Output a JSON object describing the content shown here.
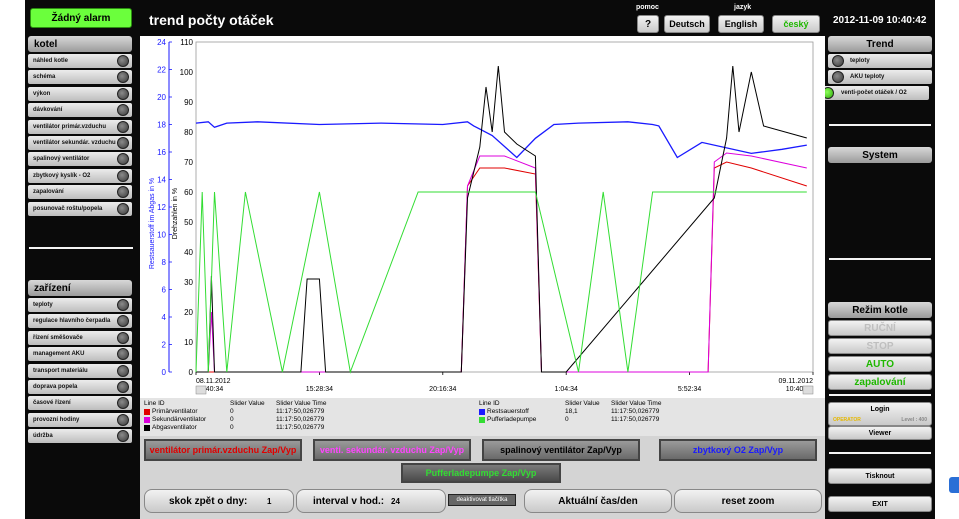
{
  "header": {
    "alarm_label": "Žádný alarm",
    "title": "trend počty otáček",
    "help_caption": "pomoc",
    "help_button": "?",
    "lang_caption": "jazyk",
    "lang_de": "Deutsch",
    "lang_en": "English",
    "lang_cz": "český",
    "datetime": "2012-11-09 10:40:42"
  },
  "left": {
    "kotel_head": "kotel",
    "kotel_items": [
      "náhled kotle",
      "schéma",
      "výkon",
      "dávkování",
      "ventilátor primár.vzduchu",
      "ventilátor sekundár. vzduchu",
      "spalinový ventilátor",
      "zbytkový kyslík - O2",
      "zapalování",
      "posunovač roštu/popela"
    ],
    "zarizeni_head": "zařízení",
    "zarizeni_items": [
      "teploty",
      "regulace hlavního čerpadla",
      "řízení směšovače",
      "management AKU",
      "transport materiálu",
      "doprava popela",
      "časové řízení",
      "provozní hodiny",
      "údržba"
    ]
  },
  "right": {
    "trend_head": "Trend",
    "trend_items": [
      "teploty",
      "AKU teploty",
      "venti-počet otáček / O2"
    ],
    "system_head": "System",
    "rezim_head": "Režim kotle",
    "modes": [
      "RUČNÍ",
      "STOP",
      "AUTO",
      "zapalování"
    ],
    "login": "Login",
    "operator": "OPERATOR",
    "level": "Level : 400",
    "viewer": "Viewer",
    "print": "Tisknout",
    "exit": "EXIT"
  },
  "chart_data": {
    "type": "line",
    "y_left_label": "Restsauerstoff im Abgas in %",
    "y_left_ticks": [
      "24",
      "22",
      "20",
      "18",
      "16",
      "14",
      "12",
      "10",
      "8",
      "6",
      "4",
      "2",
      "0"
    ],
    "y_left_range": [
      0,
      24
    ],
    "y_right_label": "Drehzahlen in %",
    "y_right_ticks": [
      "110",
      "100",
      "90",
      "80",
      "70",
      "60",
      "50",
      "40",
      "30",
      "20",
      "10",
      "0"
    ],
    "y_right_range": [
      0,
      110
    ],
    "x_ticks": [
      {
        "l1": "08.11.2012",
        "l2": "10:40:34"
      },
      {
        "l1": "",
        "l2": "15:28:34"
      },
      {
        "l1": "",
        "l2": "20:16:34"
      },
      {
        "l1": "",
        "l2": "1:04:34"
      },
      {
        "l1": "",
        "l2": "5:52:34"
      },
      {
        "l1": "09.11.2012",
        "l2": "10:40:34"
      }
    ],
    "series": [
      {
        "name": "Restsauerstoff",
        "color": "#1a1aff",
        "axis": "left",
        "x": [
          0,
          0.02,
          0.03,
          0.05,
          0.1,
          0.2,
          0.3,
          0.4,
          0.44,
          0.45,
          0.48,
          0.52,
          0.55,
          0.58,
          0.62,
          0.7,
          0.74,
          0.75,
          0.78,
          0.82,
          0.9,
          0.95,
          0.99
        ],
        "y": [
          18.1,
          18.2,
          17.8,
          18.1,
          18.2,
          18.0,
          18.1,
          18.0,
          18.2,
          17.9,
          17.2,
          15.6,
          17.0,
          18.0,
          18.1,
          18.2,
          18.0,
          17.9,
          15.6,
          16.7,
          15.9,
          16.2,
          16.5
        ]
      },
      {
        "name": "Primärventilator",
        "color": "#e00000",
        "axis": "right",
        "x": [
          0,
          0.43,
          0.44,
          0.46,
          0.5,
          0.55,
          0.56,
          0.6,
          0.7,
          0.83,
          0.84,
          0.86,
          0.9,
          0.99
        ],
        "y": [
          0,
          0,
          62,
          68,
          68,
          66,
          0,
          0,
          0,
          0,
          68,
          70,
          68,
          62
        ]
      },
      {
        "name": "Sekundärventilator",
        "color": "#dd00dd",
        "axis": "right",
        "x": [
          0,
          0.02,
          0.025,
          0.03,
          0.43,
          0.44,
          0.46,
          0.5,
          0.55,
          0.56,
          0.6,
          0.83,
          0.84,
          0.86,
          0.9,
          0.99
        ],
        "y": [
          0,
          0,
          20,
          0,
          0,
          62,
          72,
          72,
          68,
          0,
          0,
          0,
          70,
          73,
          72,
          68
        ]
      },
      {
        "name": "Abgasventilator",
        "color": "#000000",
        "axis": "right",
        "x": [
          0,
          0.02,
          0.025,
          0.03,
          0.17,
          0.18,
          0.2,
          0.21,
          0.43,
          0.44,
          0.46,
          0.47,
          0.48,
          0.49,
          0.5,
          0.52,
          0.55,
          0.56,
          0.6,
          0.84,
          0.86,
          0.87,
          0.88,
          0.9,
          0.92,
          0.99
        ],
        "y": [
          0,
          0,
          32,
          0,
          0,
          31,
          31,
          0,
          0,
          58,
          75,
          95,
          80,
          102,
          80,
          76,
          72,
          0,
          0,
          58,
          78,
          102,
          80,
          100,
          82,
          78
        ]
      },
      {
        "name": "Pufferladepumpe",
        "color": "#33dd33",
        "axis": "right",
        "x": [
          0,
          0.01,
          0.02,
          0.03,
          0.05,
          0.08,
          0.14,
          0.2,
          0.25,
          0.36,
          0.44,
          0.55,
          0.62,
          0.66,
          0.7,
          0.74,
          0.84,
          0.99
        ],
        "y": [
          0,
          60,
          0,
          60,
          0,
          60,
          0,
          60,
          0,
          60,
          60,
          60,
          0,
          60,
          0,
          60,
          60,
          60
        ]
      }
    ],
    "legend_headers": [
      "Line ID",
      "Slider Value",
      "Slider Value Time"
    ],
    "legend_rows_left": [
      {
        "name": "Primärventilator",
        "value": "0",
        "time": "11:17:50,026779",
        "color": "#e00000"
      },
      {
        "name": "Sekundärventilator",
        "value": "0",
        "time": "11:17:50,026779",
        "color": "#dd00dd"
      },
      {
        "name": "Abgasventilator",
        "value": "0",
        "time": "11:17:50,026779",
        "color": "#000000"
      }
    ],
    "legend_rows_right": [
      {
        "name": "Restsauerstoff",
        "value": "18,1",
        "time": "11:17:50,026779",
        "color": "#1a1aff"
      },
      {
        "name": "Pufferladepumpe",
        "value": "0",
        "time": "11:17:50,026779",
        "color": "#33dd33"
      }
    ]
  },
  "toggles": [
    {
      "label": "ventilátor primár.vzduchu Zap/Vyp",
      "color": "#e00000"
    },
    {
      "label": "venti. sekundár. vzduchu Zap/Vyp",
      "color": "#ff44ff"
    },
    {
      "label": "spalinový ventilátor Zap/Vyp",
      "color": "#000000"
    },
    {
      "label": "zbytkový O2 Zap/Vyp",
      "color": "#1a1aff"
    },
    {
      "label": "Pufferladepumpe Zap/Vyp",
      "color": "#33dd33"
    }
  ],
  "footer": {
    "back_days_label": "skok zpět o dny:",
    "back_days_value": "1",
    "interval_label": "interval v hod.:",
    "interval_value": "24",
    "deactivate": "deaktivovat tlačítka",
    "current": "Aktuální čas/den",
    "reset_zoom": "reset zoom"
  }
}
